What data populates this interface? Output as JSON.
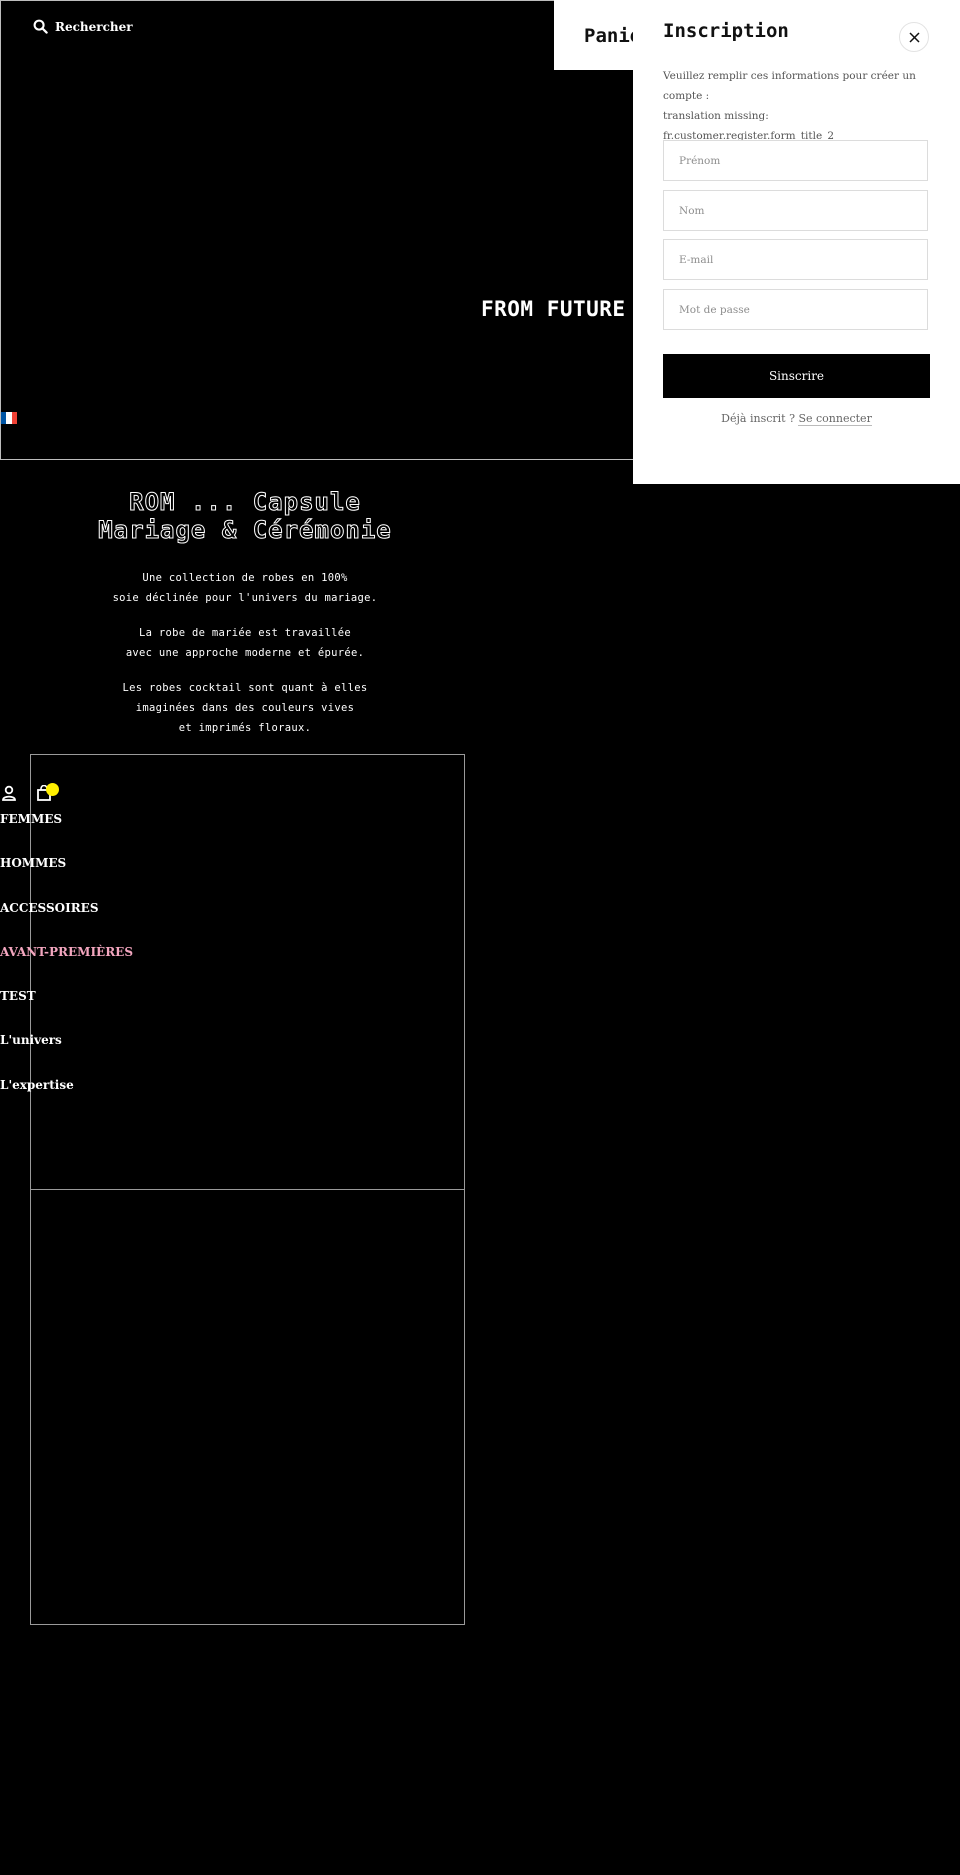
{
  "header": {
    "search_label": "Rechercher",
    "cart_title": "Panie"
  },
  "hero": {
    "title": "FROM FUTURE"
  },
  "language": {
    "flag": "fr-flag-icon",
    "colors": [
      "#0055a4",
      "#ffffff",
      "#ef4135"
    ]
  },
  "intro": {
    "heading_line1": "ROM  ...  Capsule",
    "heading_line2": "Mariage & Cérémonie",
    "paragraphs": [
      "Une collection de robes en 100%\nsoie déclinée pour l'univers du mariage.",
      "La robe de mariée est travaillée\navec une approche moderne et épurée.",
      "Les robes cocktail sont quant à elles\nimaginées dans des couleurs vives\net imprimés floraux."
    ]
  },
  "account": {
    "cart_count": ""
  },
  "nav": {
    "items": [
      {
        "label": "FEMMES"
      },
      {
        "label": "HOMMES"
      },
      {
        "label": "ACCESSOIRES"
      },
      {
        "label": "AVANT-PREMIÈRES",
        "color": "#f3a6bf"
      },
      {
        "label": "TEST"
      },
      {
        "label": "L'univers"
      },
      {
        "label": "L'expertise"
      }
    ]
  },
  "register": {
    "title": "Inscription",
    "description_line1": "Veuillez remplir ces informations pour créer un compte :",
    "description_line2": "translation missing: fr.customer.register.form_title_2",
    "first_name_placeholder": "Prénom",
    "last_name_placeholder": "Nom",
    "email_placeholder": "E-mail",
    "password_placeholder": "Mot de passe",
    "submit_label": "Sinscrire",
    "login_prompt": "Déjà inscrit ?",
    "login_link": "Se connecter"
  },
  "colors": {
    "background": "#000000",
    "accent_yellow": "#ffef00",
    "nav_highlight": "#f3a6bf"
  }
}
